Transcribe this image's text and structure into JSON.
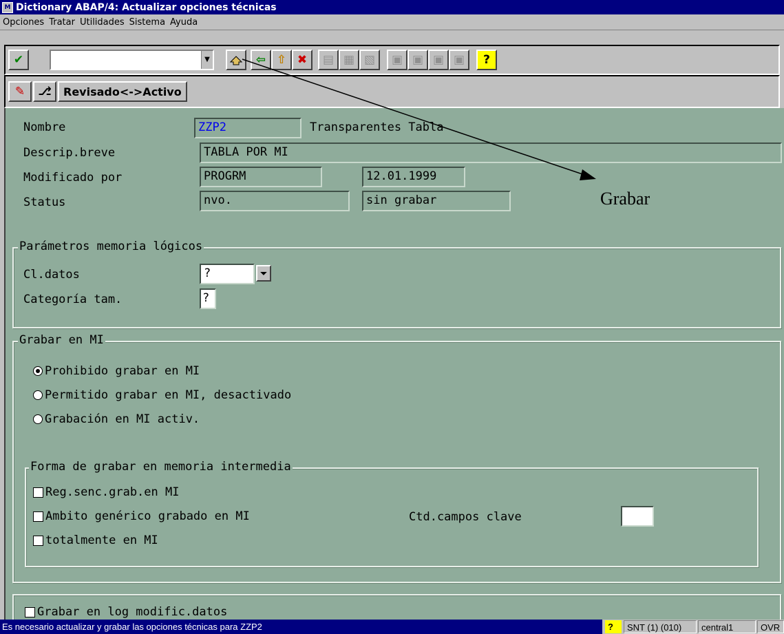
{
  "window": {
    "title": "Dictionary ABAP/4: Actualizar opciones técnicas",
    "icon": "sap-app-icon"
  },
  "menu": [
    "Opciones",
    "Tratar",
    "Utilidades",
    "Sistema",
    "Ayuda"
  ],
  "toolbar": {
    "command_value": "",
    "icons": [
      "enter-check-icon",
      "save-icon",
      "back-icon",
      "exit-icon",
      "cancel-icon",
      "print-icon",
      "find-icon",
      "find-next-icon",
      "first-page-icon",
      "prev-page-icon",
      "next-page-icon",
      "last-page-icon",
      "help-icon"
    ],
    "colors": {
      "check": "#008000",
      "back": "#008000",
      "cancel": "#cc0000",
      "help": "#ffff00"
    }
  },
  "app_toolbar": {
    "revisado_label": "Revisado<->Activo"
  },
  "header": {
    "nombre_label": "Nombre",
    "nombre_value": "ZZP2",
    "nombre_type": "Transparentes Tabla",
    "descrip_label": "Descrip.breve",
    "descrip_value": "TABLA POR MI",
    "modificado_label": "Modificado por",
    "modificado_user": "PROGRM",
    "modificado_date": "12.01.1999",
    "status_label": "Status",
    "status_value1": "nvo.",
    "status_value2": "sin grabar"
  },
  "memoria_group": {
    "title": "Parámetros memoria lógicos",
    "cl_datos_label": "Cl.datos",
    "cl_datos_value": "?",
    "categoria_label": "Categoría tam.",
    "categoria_value": "?"
  },
  "grabar_group": {
    "title": "Grabar en MI",
    "options": [
      {
        "label": "Prohibido grabar en MI",
        "selected": true
      },
      {
        "label": "Permitido grabar en MI, desactivado",
        "selected": false
      },
      {
        "label": "Grabación en MI activ.",
        "selected": false
      }
    ],
    "forma_title": "Forma de grabar en memoria intermedia",
    "forma_options": [
      {
        "label": "Reg.senc.grab.en MI",
        "checked": false
      },
      {
        "label": "Ambito genérico grabado en MI",
        "checked": false
      },
      {
        "label": "totalmente en MI",
        "checked": false
      }
    ],
    "ctd_label": "Ctd.campos clave",
    "ctd_value": ""
  },
  "log_checkbox": {
    "label": "Grabar en log modific.datos",
    "checked": false
  },
  "annotation": {
    "text": "Grabar"
  },
  "statusbar": {
    "message": "Es necesario actualizar y grabar las opciones técnicas para ZZP2",
    "system": "SNT (1) (010)",
    "server": "central1",
    "mode": "OVR"
  }
}
